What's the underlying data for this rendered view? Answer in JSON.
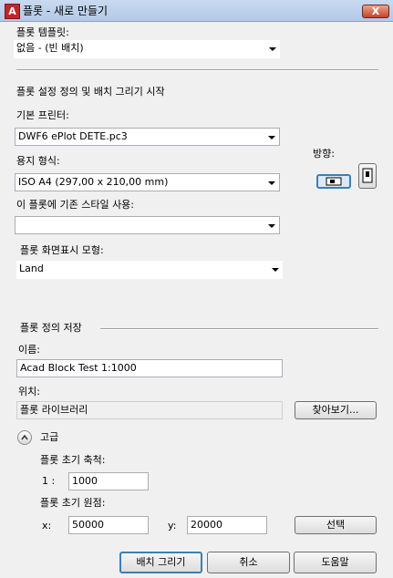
{
  "window": {
    "title": "플롯 - 새로 만들기",
    "close_label": "X"
  },
  "template": {
    "label": "플롯 템플릿:",
    "value": "없음 - (빈 배치)"
  },
  "settings": {
    "heading": "플롯 설정 정의 및 배치 그리기 시작"
  },
  "printer": {
    "label": "기본 프린터:",
    "value": "DWF6 ePlot DETE.pc3"
  },
  "paper": {
    "label": "용지 형식:",
    "value": "ISO A4 (297,00 x 210,00 mm)"
  },
  "orientation": {
    "label": "방향:",
    "landscape_icon": "landscape-page-icon",
    "portrait_icon": "portrait-page-icon",
    "selected": "landscape"
  },
  "style": {
    "label": "이 플롯에 기존 스타일 사용:",
    "value": ""
  },
  "display_model": {
    "label": "플롯 화면표시 모형:",
    "value": "Land"
  },
  "save": {
    "heading": "플롯 정의 저장",
    "name_label": "이름:",
    "name_value": "Acad Block Test 1:1000",
    "location_label": "위치:",
    "location_value": "플롯 라이브러리",
    "browse_label": "찾아보기..."
  },
  "advanced": {
    "label": "고급",
    "toggle_icon": "collapse-up-icon",
    "scale_label": "플롯 초기 축척:",
    "scale_prefix": "1 :",
    "scale_value": "1000",
    "origin_label": "플롯 초기 원점:",
    "x_label": "x:",
    "x_value": "50000",
    "y_label": "y:",
    "y_value": "20000",
    "pick_label": "선택"
  },
  "footer": {
    "create_label": "배치 그리기",
    "cancel_label": "취소",
    "help_label": "도움말"
  }
}
